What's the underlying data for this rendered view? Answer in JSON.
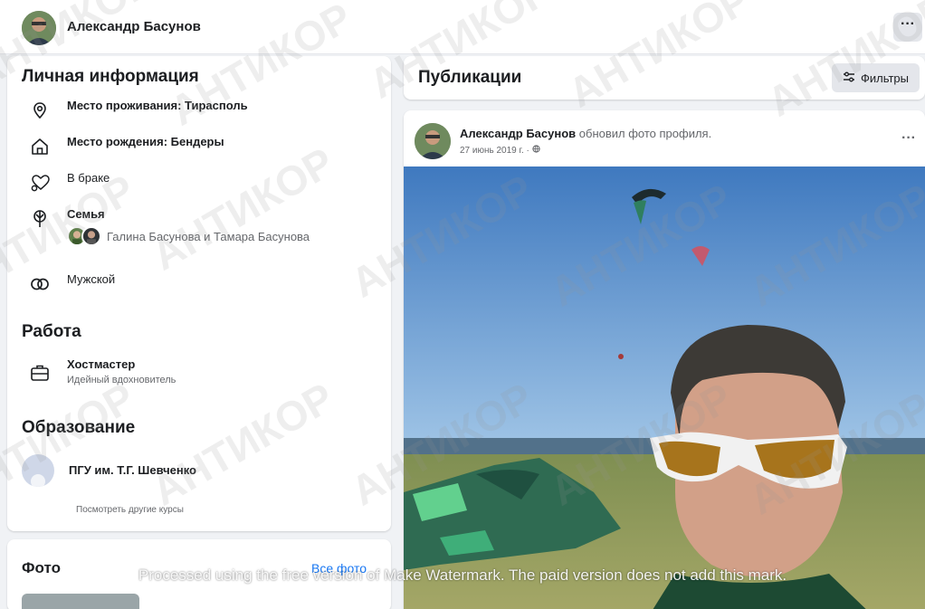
{
  "profile": {
    "name": "Александр Басунов",
    "more_label": "···"
  },
  "about": {
    "personal_title": "Личная информация",
    "items": [
      {
        "icon": "location-pin-icon",
        "text": "Место проживания: Тирасполь"
      },
      {
        "icon": "home-icon",
        "text": "Место рождения: Бендеры"
      },
      {
        "icon": "heart-icon",
        "text": "В браке"
      },
      {
        "icon": "family-icon",
        "title": "Семья",
        "names": "Галина Басунова и Тамара Басунова"
      },
      {
        "icon": "gender-icon",
        "text": "Мужской"
      }
    ],
    "work_title": "Работа",
    "work": {
      "icon": "briefcase-icon",
      "company": "Хостмастер",
      "position": "Идейный вдохновитель"
    },
    "education_title": "Образование",
    "education": {
      "school": "ПГУ им. Т.Г. Шевченко",
      "see_other": "Посмотреть другие курсы"
    }
  },
  "photos": {
    "title": "Фото",
    "all_photos": "Все фото"
  },
  "publications": {
    "title": "Публикации",
    "filters_label": "Фильтры",
    "post": {
      "author": "Александр Басунов",
      "action": "обновил фото профиля.",
      "date": "27 июнь 2019 г. · ",
      "more_label": "···"
    }
  },
  "watermark": {
    "stamp": "АНТИКОР",
    "notice": "Processed using the free version of Make Watermark. The paid version does not add this mark."
  }
}
